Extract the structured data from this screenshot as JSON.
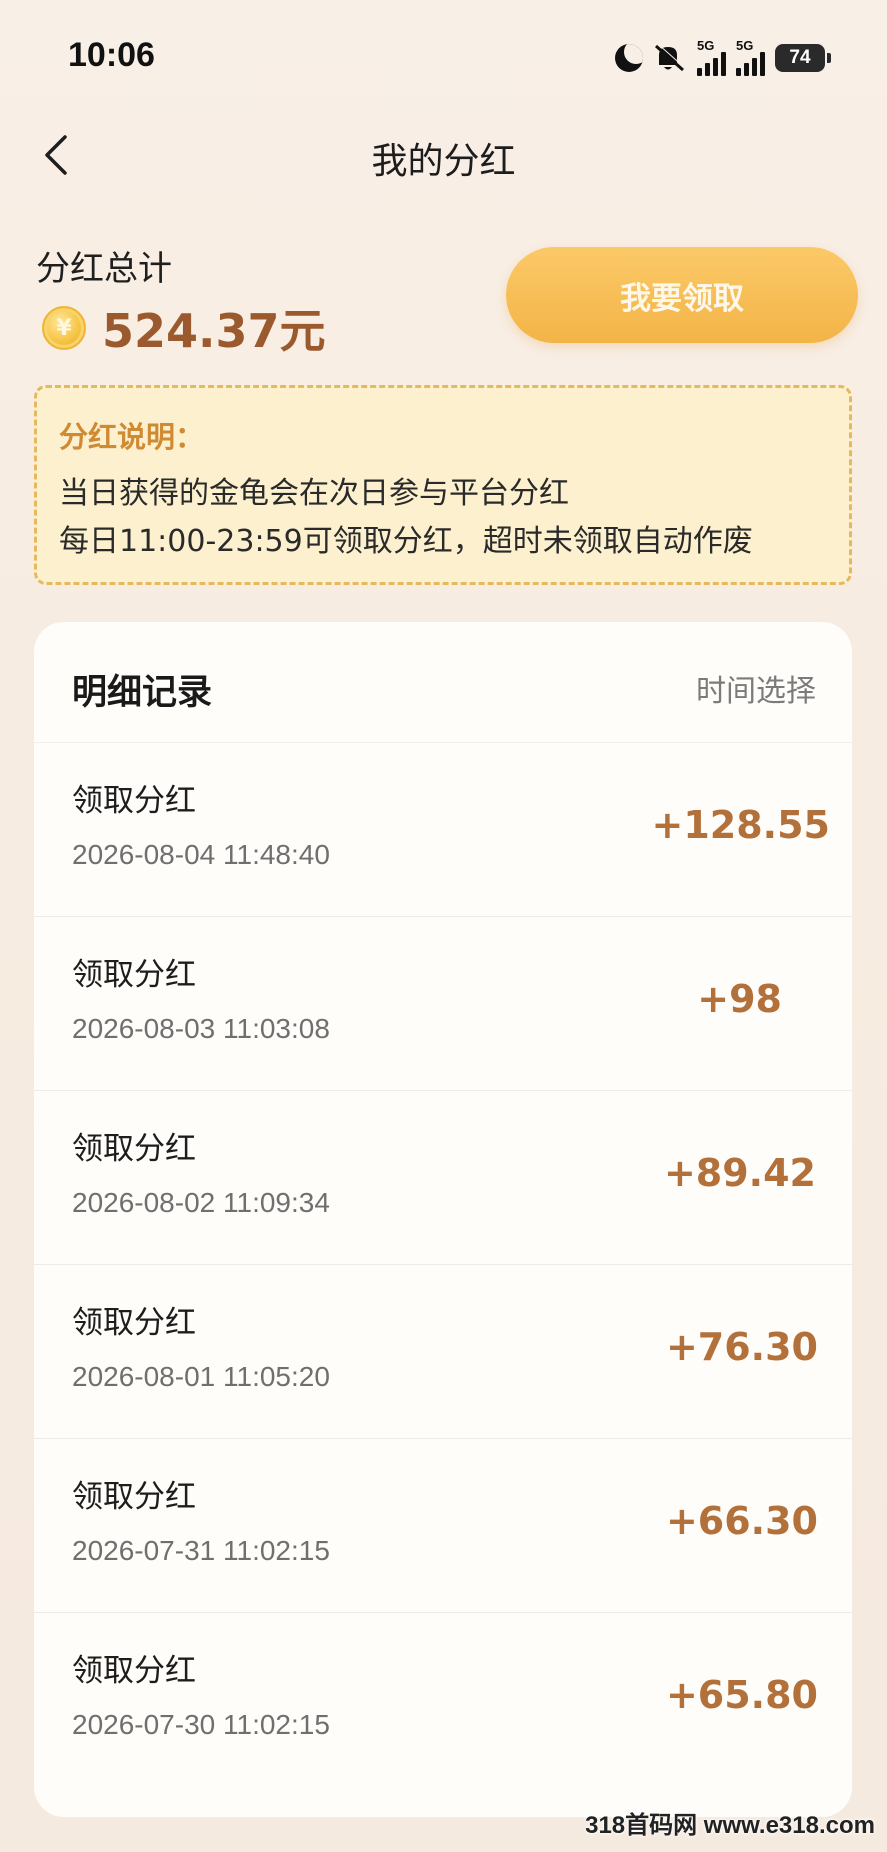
{
  "status_bar": {
    "time": "10:06",
    "net_label_1": "5G",
    "net_label_2": "5G",
    "battery": "74"
  },
  "nav": {
    "title": "我的分红"
  },
  "summary": {
    "label": "分红总计",
    "coin_symbol": "¥",
    "amount": "524.37元",
    "claim_button": "我要领取"
  },
  "notice": {
    "title": "分红说明：",
    "line1": "当日获得的金龟会在次日参与平台分红",
    "line2": "每日11:00-23:59可领取分红，超时未领取自动作废"
  },
  "records": {
    "title": "明细记录",
    "filter_label": "时间选择",
    "items": [
      {
        "title": "领取分红",
        "time": "2026-08-04 11:48:40",
        "amount": "+128.55"
      },
      {
        "title": "领取分红",
        "time": "2026-08-03 11:03:08",
        "amount": "+98"
      },
      {
        "title": "领取分红",
        "time": "2026-08-02 11:09:34",
        "amount": "+89.42"
      },
      {
        "title": "领取分红",
        "time": "2026-08-01 11:05:20",
        "amount": "+76.30"
      },
      {
        "title": "领取分红",
        "time": "2026-07-31 11:02:15",
        "amount": "+66.30"
      },
      {
        "title": "领取分红",
        "time": "2026-07-30 11:02:15",
        "amount": "+65.80"
      }
    ]
  },
  "watermark": "318首码网 www.e318.com",
  "colors": {
    "accent_button": "#f3b447",
    "amount_text": "#b2703a",
    "notice_border": "#e6b85f",
    "notice_title": "#d08a32"
  }
}
